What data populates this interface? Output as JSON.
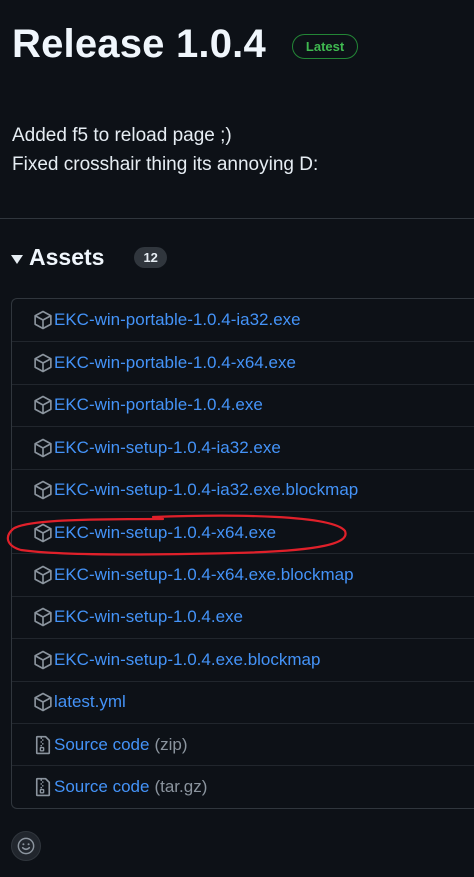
{
  "release": {
    "title": "Release 1.0.4",
    "badge": "Latest",
    "notes": [
      "Added f5 to reload page ;)",
      "Fixed crosshair thing its annoying D:"
    ]
  },
  "assets": {
    "title": "Assets",
    "count": "12",
    "items": [
      {
        "name": "EKC-win-portable-1.0.4-ia32.exe",
        "icon": "package-icon"
      },
      {
        "name": "EKC-win-portable-1.0.4-x64.exe",
        "icon": "package-icon"
      },
      {
        "name": "EKC-win-portable-1.0.4.exe",
        "icon": "package-icon"
      },
      {
        "name": "EKC-win-setup-1.0.4-ia32.exe",
        "icon": "package-icon"
      },
      {
        "name": "EKC-win-setup-1.0.4-ia32.exe.blockmap",
        "icon": "package-icon"
      },
      {
        "name": "EKC-win-setup-1.0.4-x64.exe",
        "icon": "package-icon"
      },
      {
        "name": "EKC-win-setup-1.0.4-x64.exe.blockmap",
        "icon": "package-icon"
      },
      {
        "name": "EKC-win-setup-1.0.4.exe",
        "icon": "package-icon"
      },
      {
        "name": "EKC-win-setup-1.0.4.exe.blockmap",
        "icon": "package-icon"
      },
      {
        "name": "latest.yml",
        "icon": "package-icon"
      },
      {
        "name": "Source code",
        "ext": "(zip)",
        "icon": "file-zip-icon"
      },
      {
        "name": "Source code",
        "ext": "(tar.gz)",
        "icon": "file-zip-icon"
      }
    ]
  },
  "colors": {
    "background": "#0d1117",
    "link": "#4493f8",
    "latest_badge": "#3fb950",
    "annotation": "#e0202a"
  }
}
